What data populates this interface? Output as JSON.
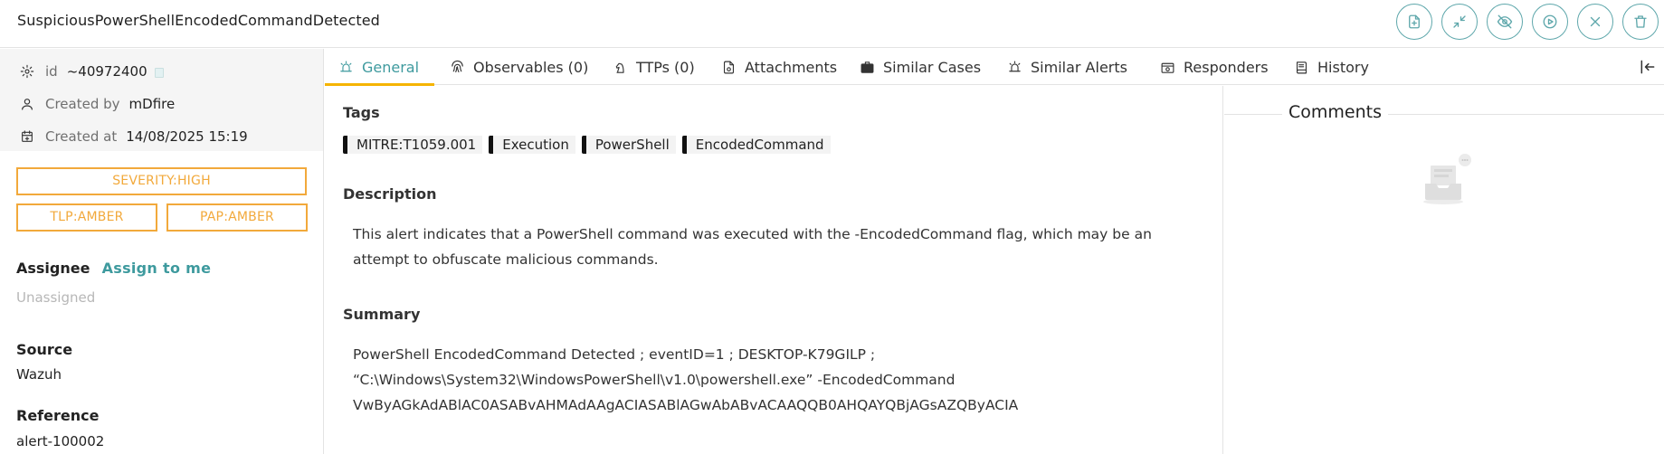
{
  "header": {
    "title": "SuspiciousPowerShellEncodedCommandDetected",
    "actions": [
      {
        "name": "create-case-button",
        "icon": "file-plus-icon"
      },
      {
        "name": "merge-button",
        "icon": "shrink-arrows-icon"
      },
      {
        "name": "ignore-button",
        "icon": "eye-off-icon"
      },
      {
        "name": "run-button",
        "icon": "play-circle-icon"
      },
      {
        "name": "close-button",
        "icon": "close-icon"
      },
      {
        "name": "delete-button",
        "icon": "trash-icon"
      }
    ]
  },
  "sidebar": {
    "id_label": "id",
    "id_value": "~40972400",
    "created_by_label": "Created by",
    "created_by_value": "mDfire",
    "created_at_label": "Created at",
    "created_at_value": "14/08/2025 15:19",
    "severity": "SEVERITY:HIGH",
    "tlp": "TLP:AMBER",
    "pap": "PAP:AMBER",
    "assignee_label": "Assignee",
    "assign_link": "Assign to me",
    "assignee_value": "Unassigned",
    "source_label": "Source",
    "source_value": "Wazuh",
    "reference_label": "Reference",
    "reference_value": "alert-100002"
  },
  "tabs": [
    {
      "label": "General",
      "icon": "alarm-icon",
      "active": true
    },
    {
      "label": "Observables (0)",
      "icon": "fingerprint-icon"
    },
    {
      "label": "TTPs (0)",
      "icon": "chess-knight-icon"
    },
    {
      "label": "Attachments",
      "icon": "attachment-icon"
    },
    {
      "label": "Similar Cases",
      "icon": "briefcase-icon"
    },
    {
      "label": "Similar Alerts",
      "icon": "siren-icon"
    },
    {
      "label": "Responders",
      "icon": "responder-gear-icon"
    },
    {
      "label": "History",
      "icon": "book-icon"
    }
  ],
  "main": {
    "tags_title": "Tags",
    "tags": [
      "MITRE:T1059.001",
      "Execution",
      "PowerShell",
      "EncodedCommand"
    ],
    "description_title": "Description",
    "description_lines": [
      "This alert indicates that a PowerShell command was executed with the -EncodedCommand flag, which may be an",
      "attempt to obfuscate malicious commands."
    ],
    "summary_title": "Summary",
    "summary_lines": [
      "PowerShell EncodedCommand Detected ; eventID=1 ; DESKTOP-K79GILP ;",
      "“C:\\Windows\\System32\\WindowsPowerShell\\v1.0\\powershell.exe” -EncodedCommand",
      "VwByAGkAdABlAC0ASABvAHMAdAAgACIASABlAGwAbABvACAAQQB0AHQAYQBjAGsAZQByACIA"
    ]
  },
  "comments": {
    "title": "Comments"
  },
  "colors": {
    "accent": "#3e9a9e",
    "amber": "#f2a93b",
    "tab_underline": "#f5b400"
  }
}
